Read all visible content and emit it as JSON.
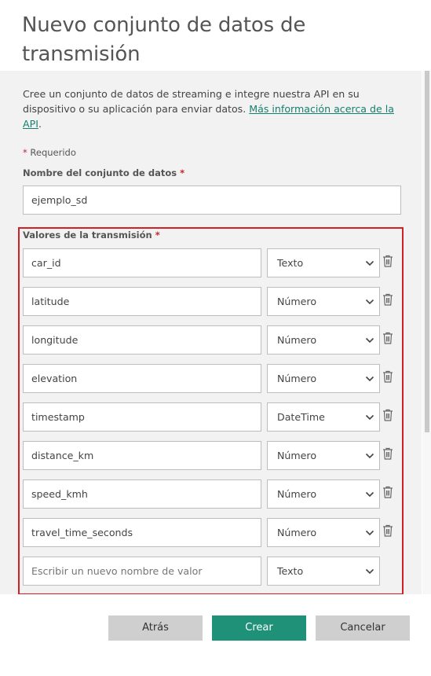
{
  "dialog": {
    "title": "Nuevo conjunto de datos de transmisión",
    "description": "Cree un conjunto de datos de streaming e integre nuestra API en su dispositivo o su aplicación para enviar datos.",
    "learn_more_link": "Más información acerca de la API",
    "description_end": ".",
    "required_asterisk": "*",
    "required_note": "Requerido"
  },
  "dataset_name": {
    "label": "Nombre del conjunto de datos",
    "value": "ejemplo_sd"
  },
  "stream_values": {
    "label": "Valores de la transmisión",
    "rows": [
      {
        "name": "car_id",
        "type": "Texto"
      },
      {
        "name": "latitude",
        "type": "Número"
      },
      {
        "name": "longitude",
        "type": "Número"
      },
      {
        "name": "elevation",
        "type": "Número"
      },
      {
        "name": "timestamp",
        "type": "DateTime"
      },
      {
        "name": "distance_km",
        "type": "Número"
      },
      {
        "name": "speed_kmh",
        "type": "Número"
      },
      {
        "name": "travel_time_seconds",
        "type": "Número"
      }
    ],
    "new_row": {
      "placeholder": "Escribir un nuevo nombre de valor",
      "type": "Texto"
    }
  },
  "buttons": {
    "back": "Atrás",
    "create": "Crear",
    "cancel": "Cancelar"
  },
  "colors": {
    "accent": "#1f9179",
    "link": "#15806f",
    "highlight_frame": "#d31f26",
    "required": "#c4262e"
  }
}
